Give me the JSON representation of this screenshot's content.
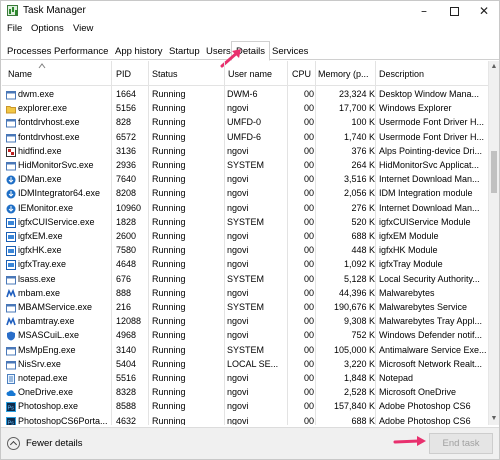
{
  "window": {
    "title": "Task Manager"
  },
  "menu": [
    "File",
    "Options",
    "View"
  ],
  "tabs": [
    {
      "label": "Processes",
      "active": false
    },
    {
      "label": "Performance",
      "active": false
    },
    {
      "label": "App history",
      "active": false
    },
    {
      "label": "Startup",
      "active": false
    },
    {
      "label": "Users",
      "active": false
    },
    {
      "label": "Details",
      "active": true
    },
    {
      "label": "Services",
      "active": false
    }
  ],
  "table": {
    "columns": [
      "Name",
      "PID",
      "Status",
      "User name",
      "CPU",
      "Memory (p...",
      "Description"
    ],
    "sorted_by": "Name",
    "rows": [
      {
        "icon": "window-icon",
        "name": "dwm.exe",
        "pid": "1664",
        "status": "Running",
        "user": "DWM-6",
        "cpu": "00",
        "mem": "23,324 K",
        "desc": "Desktop Window Mana..."
      },
      {
        "icon": "folder-icon",
        "name": "explorer.exe",
        "pid": "5156",
        "status": "Running",
        "user": "ngovi",
        "cpu": "00",
        "mem": "17,700 K",
        "desc": "Windows Explorer"
      },
      {
        "icon": "window-icon",
        "name": "fontdrvhost.exe",
        "pid": "828",
        "status": "Running",
        "user": "UMFD-0",
        "cpu": "00",
        "mem": "100 K",
        "desc": "Usermode Font Driver H..."
      },
      {
        "icon": "window-icon",
        "name": "fontdrvhost.exe",
        "pid": "6572",
        "status": "Running",
        "user": "UMFD-6",
        "cpu": "00",
        "mem": "1,740 K",
        "desc": "Usermode Font Driver H..."
      },
      {
        "icon": "hidfind-icon",
        "name": "hidfind.exe",
        "pid": "3136",
        "status": "Running",
        "user": "ngovi",
        "cpu": "00",
        "mem": "376 K",
        "desc": "Alps Pointing-device Dri..."
      },
      {
        "icon": "window-icon",
        "name": "HidMonitorSvc.exe",
        "pid": "2936",
        "status": "Running",
        "user": "SYSTEM",
        "cpu": "00",
        "mem": "264 K",
        "desc": "HidMonitorSvc Applicat..."
      },
      {
        "icon": "idm-icon",
        "name": "IDMan.exe",
        "pid": "7640",
        "status": "Running",
        "user": "ngovi",
        "cpu": "00",
        "mem": "3,516 K",
        "desc": "Internet Download Man..."
      },
      {
        "icon": "idm-icon",
        "name": "IDMIntegrator64.exe",
        "pid": "8208",
        "status": "Running",
        "user": "ngovi",
        "cpu": "00",
        "mem": "2,056 K",
        "desc": "IDM Integration module"
      },
      {
        "icon": "idm-icon",
        "name": "IEMonitor.exe",
        "pid": "10960",
        "status": "Running",
        "user": "ngovi",
        "cpu": "00",
        "mem": "276 K",
        "desc": "Internet Download Man..."
      },
      {
        "icon": "intel-icon",
        "name": "igfxCUIService.exe",
        "pid": "1828",
        "status": "Running",
        "user": "SYSTEM",
        "cpu": "00",
        "mem": "520 K",
        "desc": "igfxCUIService Module"
      },
      {
        "icon": "intel-icon",
        "name": "igfxEM.exe",
        "pid": "2600",
        "status": "Running",
        "user": "ngovi",
        "cpu": "00",
        "mem": "688 K",
        "desc": "igfxEM Module"
      },
      {
        "icon": "intel-icon",
        "name": "igfxHK.exe",
        "pid": "7580",
        "status": "Running",
        "user": "ngovi",
        "cpu": "00",
        "mem": "448 K",
        "desc": "igfxHK Module"
      },
      {
        "icon": "intel-icon",
        "name": "igfxTray.exe",
        "pid": "4648",
        "status": "Running",
        "user": "ngovi",
        "cpu": "00",
        "mem": "1,092 K",
        "desc": "igfxTray Module"
      },
      {
        "icon": "window-icon",
        "name": "lsass.exe",
        "pid": "676",
        "status": "Running",
        "user": "SYSTEM",
        "cpu": "00",
        "mem": "5,128 K",
        "desc": "Local Security Authority..."
      },
      {
        "icon": "malwarebytes-icon",
        "name": "mbam.exe",
        "pid": "888",
        "status": "Running",
        "user": "ngovi",
        "cpu": "00",
        "mem": "44,396 K",
        "desc": "Malwarebytes"
      },
      {
        "icon": "window-icon",
        "name": "MBAMService.exe",
        "pid": "216",
        "status": "Running",
        "user": "SYSTEM",
        "cpu": "00",
        "mem": "190,676 K",
        "desc": "Malwarebytes Service"
      },
      {
        "icon": "malwarebytes-icon",
        "name": "mbamtray.exe",
        "pid": "12088",
        "status": "Running",
        "user": "ngovi",
        "cpu": "00",
        "mem": "9,308 K",
        "desc": "Malwarebytes Tray Appl..."
      },
      {
        "icon": "shield-icon",
        "name": "MSASCuiL.exe",
        "pid": "4968",
        "status": "Running",
        "user": "ngovi",
        "cpu": "00",
        "mem": "752 K",
        "desc": "Windows Defender notif..."
      },
      {
        "icon": "window-icon",
        "name": "MsMpEng.exe",
        "pid": "3140",
        "status": "Running",
        "user": "SYSTEM",
        "cpu": "00",
        "mem": "105,000 K",
        "desc": "Antimalware Service Exe..."
      },
      {
        "icon": "window-icon",
        "name": "NisSrv.exe",
        "pid": "5404",
        "status": "Running",
        "user": "LOCAL SE...",
        "cpu": "00",
        "mem": "3,220 K",
        "desc": "Microsoft Network Realt..."
      },
      {
        "icon": "notepad-icon",
        "name": "notepad.exe",
        "pid": "5516",
        "status": "Running",
        "user": "ngovi",
        "cpu": "00",
        "mem": "1,848 K",
        "desc": "Notepad"
      },
      {
        "icon": "onedrive-icon",
        "name": "OneDrive.exe",
        "pid": "8328",
        "status": "Running",
        "user": "ngovi",
        "cpu": "00",
        "mem": "2,528 K",
        "desc": "Microsoft OneDrive"
      },
      {
        "icon": "photoshop-icon",
        "name": "Photoshop.exe",
        "pid": "8588",
        "status": "Running",
        "user": "ngovi",
        "cpu": "00",
        "mem": "157,840 K",
        "desc": "Adobe Photoshop CS6"
      },
      {
        "icon": "photoshop-icon",
        "name": "PhotoshopCS6Porta...",
        "pid": "4632",
        "status": "Running",
        "user": "ngovi",
        "cpu": "00",
        "mem": "688 K",
        "desc": "Adobe Photoshop CS6"
      }
    ]
  },
  "footer": {
    "fewer_details": "Fewer details",
    "end_task": "End task"
  },
  "colors": {
    "accent_arrow": "#e8306e",
    "selected_tab_border": "#d0d0d0",
    "disabled_text": "#a0a0a0"
  }
}
